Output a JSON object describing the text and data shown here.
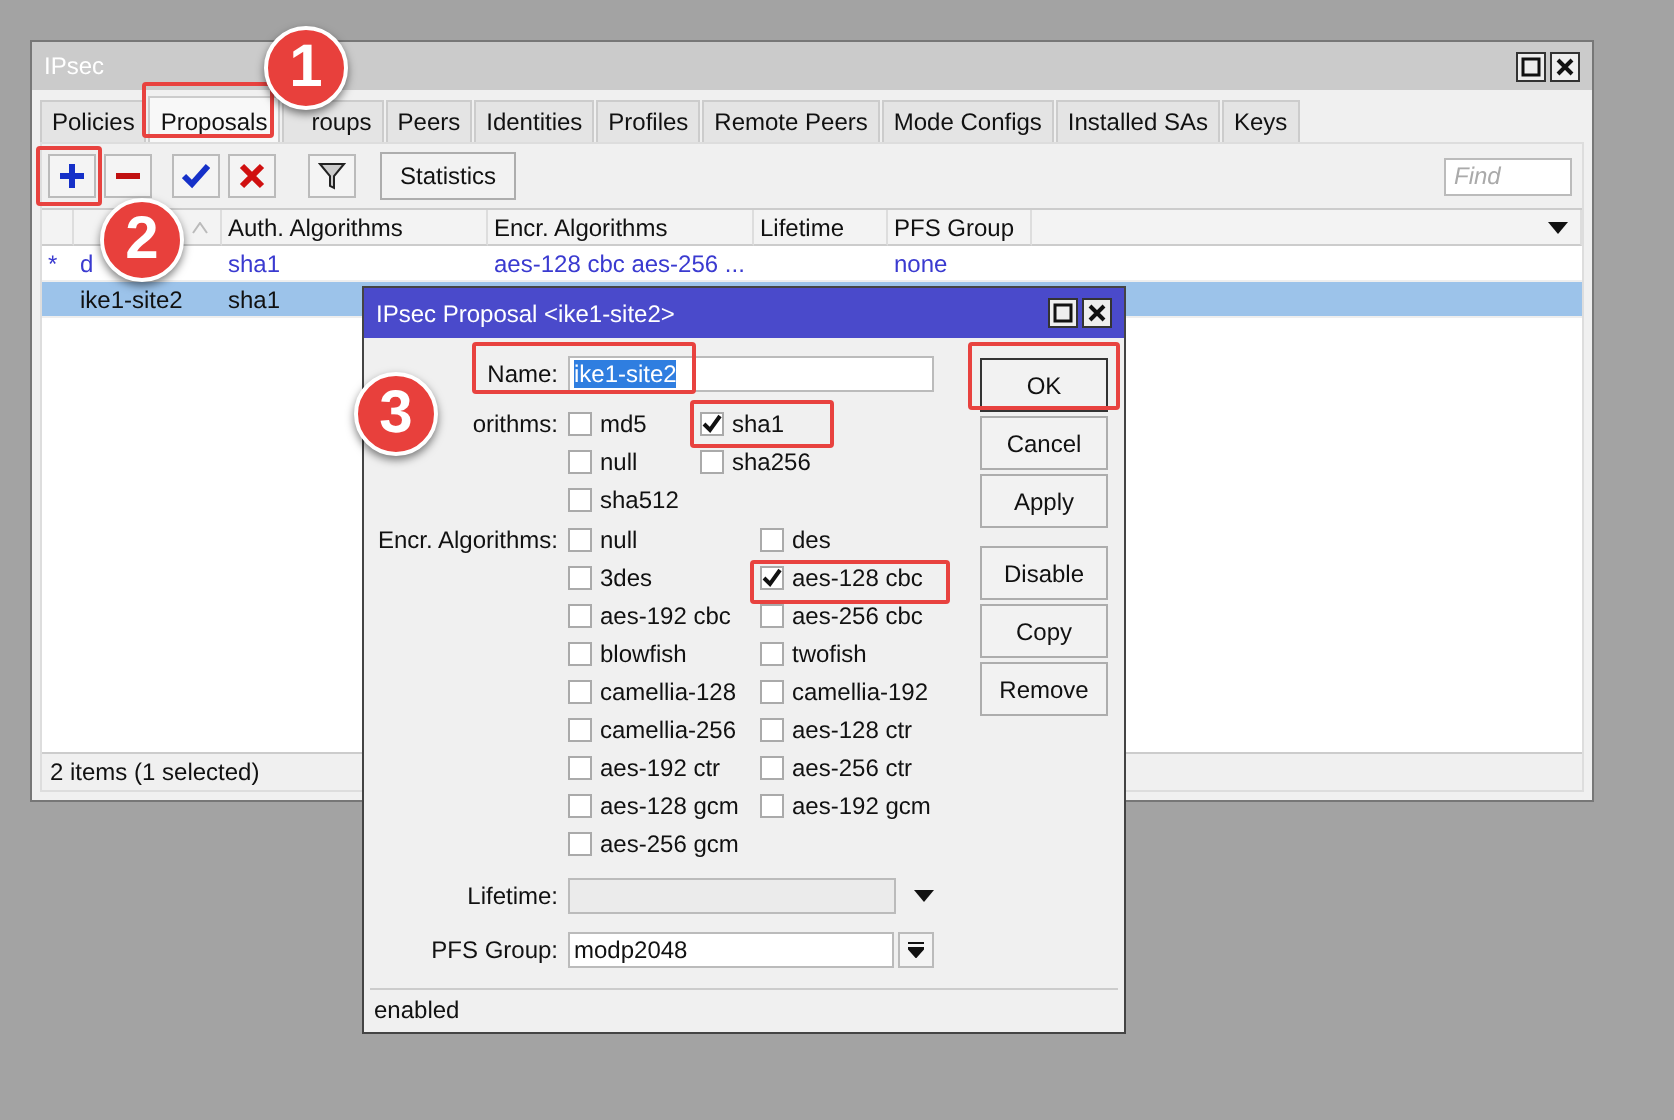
{
  "window": {
    "title": "IPsec"
  },
  "tabs": [
    {
      "label": "Policies",
      "selected": false
    },
    {
      "label": "Proposals",
      "selected": true
    },
    {
      "label": "roups",
      "selected": false
    },
    {
      "label": "Peers",
      "selected": false
    },
    {
      "label": "Identities",
      "selected": false
    },
    {
      "label": "Profiles",
      "selected": false
    },
    {
      "label": "Remote Peers",
      "selected": false
    },
    {
      "label": "Mode Configs",
      "selected": false
    },
    {
      "label": "Installed SAs",
      "selected": false
    },
    {
      "label": "Keys",
      "selected": false
    }
  ],
  "toolbar": {
    "statistics": "Statistics",
    "find_placeholder": "Find"
  },
  "table": {
    "columns": [
      "Auth. Algorithms",
      "Encr. Algorithms",
      "Lifetime",
      "PFS Group"
    ],
    "rows": [
      {
        "flag": "*",
        "name": "d",
        "auth": "sha1",
        "encr": "aes-128 cbc aes-256 ...",
        "pfs": "none",
        "dynamic": true,
        "selected": false
      },
      {
        "name": "ike1-site2",
        "auth": "sha1",
        "dynamic": false,
        "selected": true
      }
    ]
  },
  "status_bar": "2 items (1 selected)",
  "dialog": {
    "title": "IPsec Proposal <ike1-site2>",
    "name_label": "Name:",
    "name_value": "ike1-site2",
    "auth_label": "orithms:",
    "auth_options": [
      {
        "label": "md5",
        "checked": false
      },
      {
        "label": "sha1",
        "checked": true
      },
      {
        "label": "null",
        "checked": false
      },
      {
        "label": "sha256",
        "checked": false
      },
      {
        "label": "sha512",
        "checked": false
      }
    ],
    "encr_label": "Encr. Algorithms:",
    "encr_options": [
      {
        "label": "null",
        "checked": false
      },
      {
        "label": "des",
        "checked": false
      },
      {
        "label": "3des",
        "checked": false
      },
      {
        "label": "aes-128 cbc",
        "checked": true
      },
      {
        "label": "aes-192 cbc",
        "checked": false
      },
      {
        "label": "aes-256 cbc",
        "checked": false
      },
      {
        "label": "blowfish",
        "checked": false
      },
      {
        "label": "twofish",
        "checked": false
      },
      {
        "label": "camellia-128",
        "checked": false
      },
      {
        "label": "camellia-192",
        "checked": false
      },
      {
        "label": "camellia-256",
        "checked": false
      },
      {
        "label": "aes-128 ctr",
        "checked": false
      },
      {
        "label": "aes-192 ctr",
        "checked": false
      },
      {
        "label": "aes-256 ctr",
        "checked": false
      },
      {
        "label": "aes-128 gcm",
        "checked": false
      },
      {
        "label": "aes-192 gcm",
        "checked": false
      },
      {
        "label": "aes-256 gcm",
        "checked": false
      }
    ],
    "lifetime_label": "Lifetime:",
    "pfs_label": "PFS Group:",
    "pfs_value": "modp2048",
    "buttons": [
      "OK",
      "Cancel",
      "Apply",
      "Disable",
      "Copy",
      "Remove"
    ],
    "status": "enabled"
  },
  "annotations": [
    {
      "number": "1"
    },
    {
      "number": "2"
    },
    {
      "number": "3"
    }
  ]
}
